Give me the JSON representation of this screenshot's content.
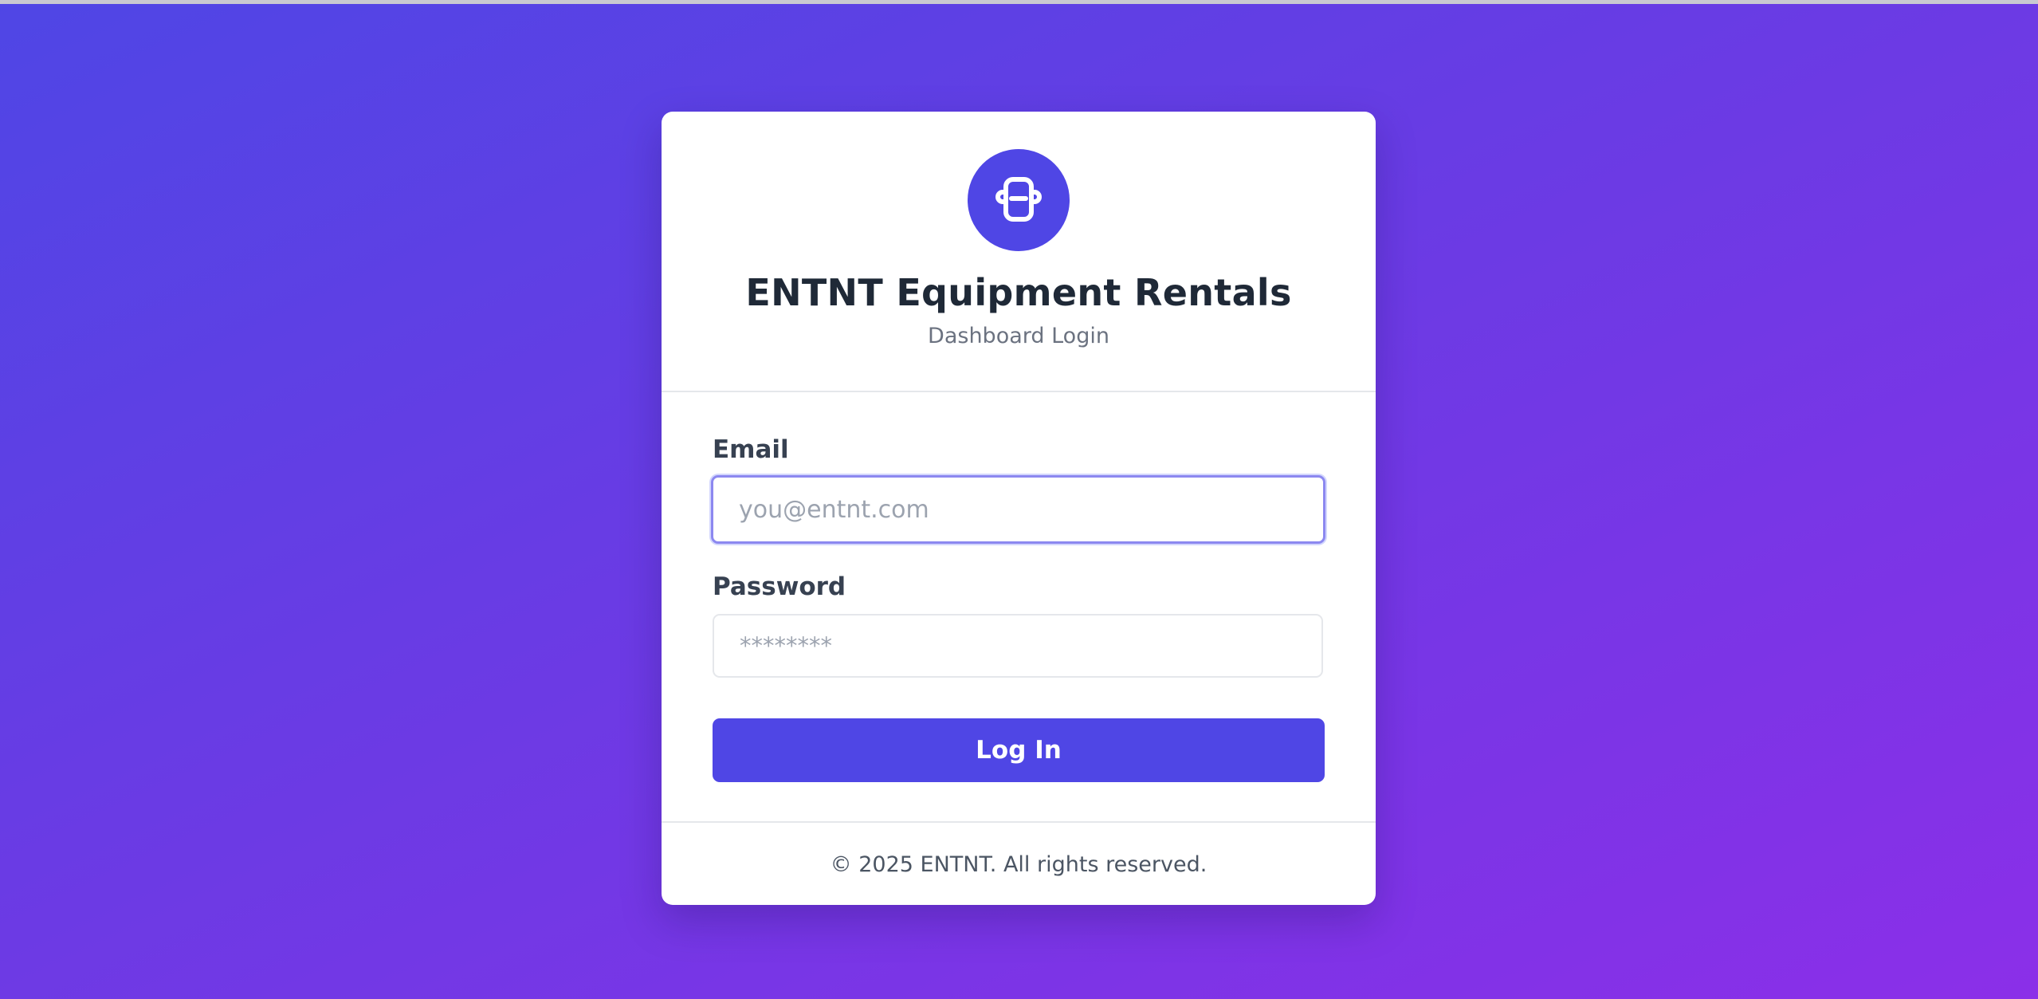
{
  "header": {
    "logo_icon": "equipment-logo-icon",
    "title": "ENTNT Equipment Rentals",
    "subtitle": "Dashboard Login"
  },
  "form": {
    "email": {
      "label": "Email",
      "placeholder": "you@entnt.com",
      "value": ""
    },
    "password": {
      "label": "Password",
      "placeholder": "********",
      "value": ""
    },
    "submit_label": "Log In"
  },
  "footer": {
    "copyright": "© 2025 ENTNT. All rights reserved."
  },
  "colors": {
    "accent": "#4f46e5",
    "background_start": "#4f46e5",
    "background_end": "#8b2fe8",
    "focus_ring": "#8c88f0"
  }
}
